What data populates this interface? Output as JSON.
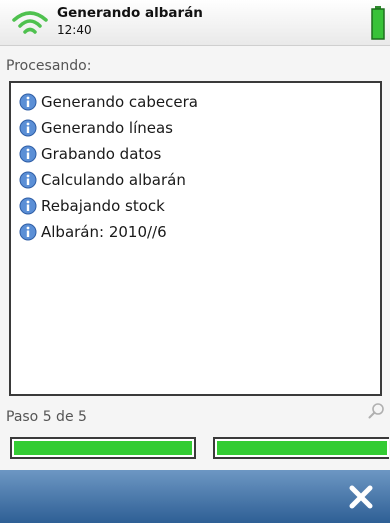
{
  "status_bar": {
    "title": "Generando albarán",
    "time": "12:40",
    "icons": [
      "wifi-icon",
      "battery-icon"
    ]
  },
  "colors": {
    "progress_fill": "#33cc33",
    "bottom_bar": "#3f6fa5"
  },
  "main": {
    "label": "Procesando:",
    "log": [
      {
        "icon": "info-icon",
        "text": "Generando cabecera"
      },
      {
        "icon": "info-icon",
        "text": "Generando líneas"
      },
      {
        "icon": "info-icon",
        "text": "Grabando datos"
      },
      {
        "icon": "info-icon",
        "text": "Calculando albarán"
      },
      {
        "icon": "info-icon",
        "text": "Rebajando stock"
      },
      {
        "icon": "info-icon",
        "text": "Albarán: 2010//6"
      }
    ]
  },
  "progress": {
    "step_label": "Paso 5 de 5",
    "overall_fraction": 1.0,
    "step_fraction": 1.0
  },
  "bottom_bar": {
    "close_icon": "close-icon"
  }
}
